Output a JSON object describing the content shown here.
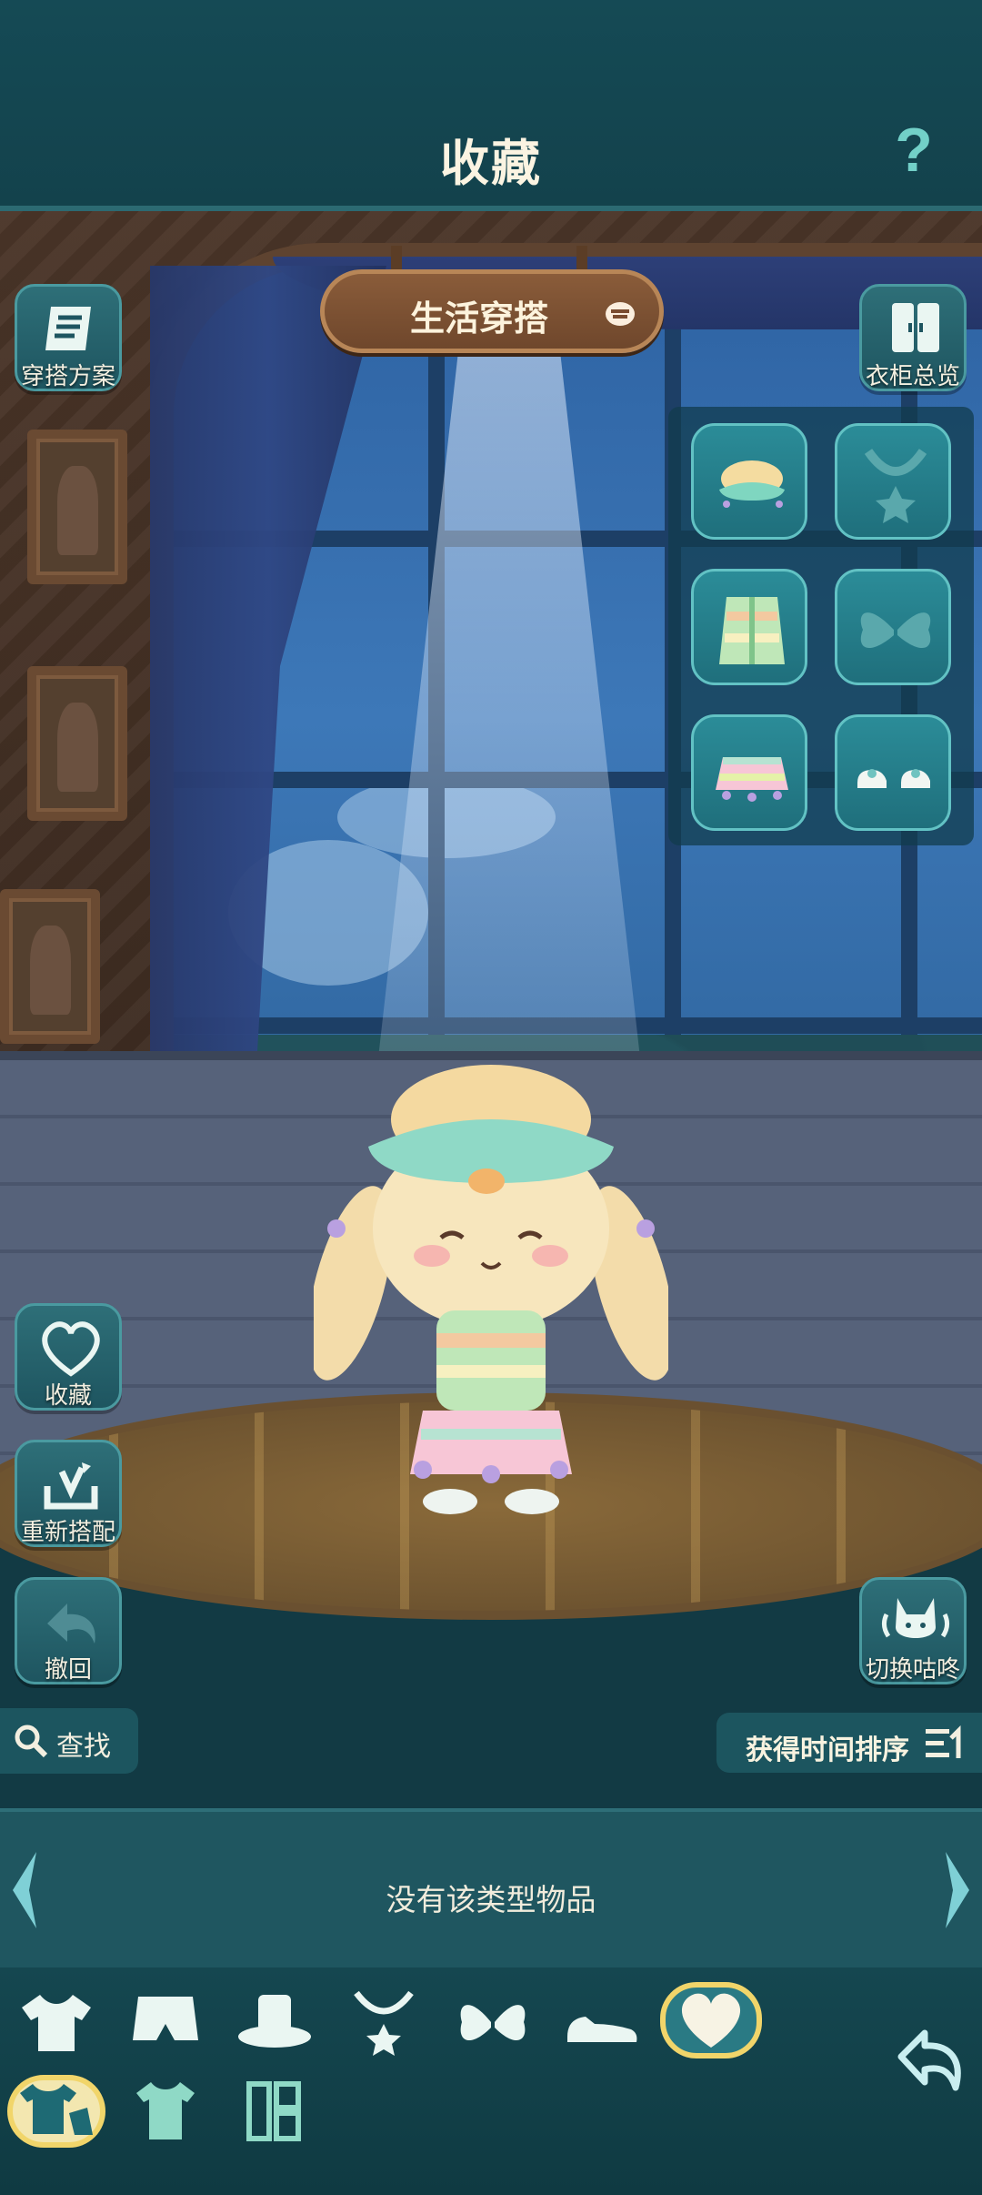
{
  "header": {
    "title": "收藏",
    "help_symbol": "?"
  },
  "outfit_type": {
    "label": "生活穿搭"
  },
  "left_buttons": {
    "outfit_plan": "穿搭方案",
    "favorite": "收藏",
    "rematch": "重新搭配",
    "undo": "撤回"
  },
  "right_buttons": {
    "wardrobe_overview": "衣柜总览",
    "switch_character": "切换咕咚"
  },
  "equipped_slots": [
    {
      "name": "hat",
      "icon": "hat-icon",
      "filled": true
    },
    {
      "name": "necklace",
      "icon": "necklace-icon",
      "filled": false
    },
    {
      "name": "top",
      "icon": "vest-icon",
      "filled": true
    },
    {
      "name": "wings",
      "icon": "wings-icon",
      "filled": false
    },
    {
      "name": "skirt",
      "icon": "skirt-icon",
      "filled": true
    },
    {
      "name": "shoes",
      "icon": "shoes-icon",
      "filled": true
    }
  ],
  "toolbar": {
    "search_label": "查找",
    "sort_label": "获得时间排序"
  },
  "item_list": {
    "empty_message": "没有该类型物品"
  },
  "category_tabs": [
    {
      "icon": "shirt-icon",
      "active": false
    },
    {
      "icon": "pants-icon",
      "active": false
    },
    {
      "icon": "hat-icon",
      "active": false
    },
    {
      "icon": "necklace-icon",
      "active": false
    },
    {
      "icon": "wings-icon",
      "active": false
    },
    {
      "icon": "shoes-icon",
      "active": false
    },
    {
      "icon": "heart-icon",
      "active": true
    }
  ],
  "sub_tabs": [
    {
      "icon": "outfit-set-icon",
      "active": true
    },
    {
      "icon": "clothing-icon",
      "active": false
    },
    {
      "icon": "style-icon",
      "active": false
    }
  ],
  "colors": {
    "accent": "#f1d56a",
    "panel": "#1f5660",
    "header": "#154a55",
    "text": "#f3efe0"
  }
}
